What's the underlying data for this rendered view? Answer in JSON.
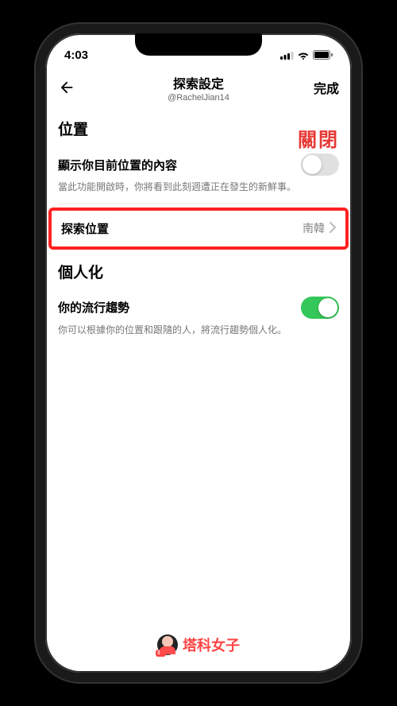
{
  "status_bar": {
    "time": "4:03"
  },
  "nav": {
    "title": "探索設定",
    "subtitle": "@RachelJian14",
    "done": "完成"
  },
  "annotations": {
    "off_label": "關閉"
  },
  "sections": {
    "location": {
      "header": "位置",
      "show_current": {
        "label": "顯示你目前位置的內容",
        "desc": "當此功能開啟時，你將看到此刻週遭正在發生的新鮮事。",
        "enabled": false
      },
      "explore_location": {
        "label": "探索位置",
        "value": "南韓"
      }
    },
    "personalization": {
      "header": "個人化",
      "trends": {
        "label": "你的流行趨勢",
        "desc": "你可以根據你的位置和跟隨的人，將流行趨勢個人化。",
        "enabled": true
      }
    }
  },
  "watermark": {
    "text": "塔科女子",
    "badge": "3C"
  }
}
